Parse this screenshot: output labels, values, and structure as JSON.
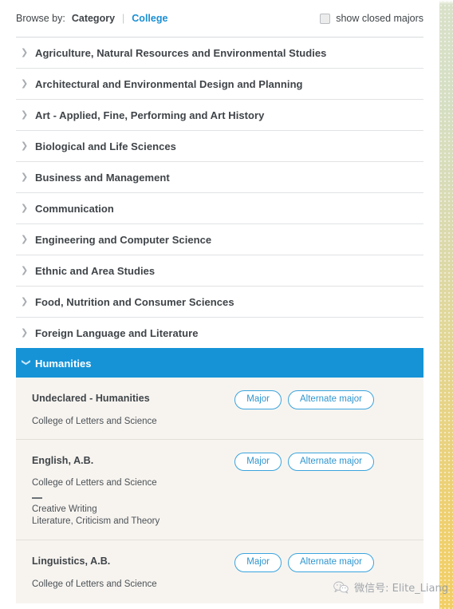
{
  "browse_bar": {
    "label": "Browse by:",
    "options": [
      {
        "label": "Category",
        "active": true
      },
      {
        "label": "College",
        "active": false
      }
    ],
    "separator": "|",
    "checkbox_label": "show closed majors",
    "checkbox_checked": false
  },
  "categories": [
    {
      "label": "Agriculture, Natural Resources and Environmental Studies",
      "expanded": false,
      "chevron": "chevron-right-icon"
    },
    {
      "label": "Architectural and Environmental Design and Planning",
      "expanded": false,
      "chevron": "chevron-right-icon"
    },
    {
      "label": "Art - Applied, Fine, Performing and Art History",
      "expanded": false,
      "chevron": "chevron-right-icon"
    },
    {
      "label": "Biological and Life Sciences",
      "expanded": false,
      "chevron": "chevron-right-icon"
    },
    {
      "label": "Business and Management",
      "expanded": false,
      "chevron": "chevron-right-icon"
    },
    {
      "label": "Communication",
      "expanded": false,
      "chevron": "chevron-right-icon"
    },
    {
      "label": "Engineering and Computer Science",
      "expanded": false,
      "chevron": "chevron-right-icon"
    },
    {
      "label": "Ethnic and Area Studies",
      "expanded": false,
      "chevron": "chevron-right-icon"
    },
    {
      "label": "Food, Nutrition and Consumer Sciences",
      "expanded": false,
      "chevron": "chevron-right-icon"
    },
    {
      "label": "Foreign Language and Literature",
      "expanded": false,
      "chevron": "chevron-right-icon"
    },
    {
      "label": "Humanities",
      "expanded": true,
      "chevron": "chevron-down-icon"
    }
  ],
  "expanded_category": {
    "label": "Humanities",
    "majors": [
      {
        "name": "Undeclared - Humanities",
        "college": "College of Letters and Science",
        "major_button": "Major",
        "alternate_button": "Alternate major",
        "specializations": []
      },
      {
        "name": "English,  A.B.",
        "college": "College of Letters and Science",
        "major_button": "Major",
        "alternate_button": "Alternate major",
        "specializations": [
          "Creative Writing",
          "Literature, Criticism and Theory"
        ]
      },
      {
        "name": "Linguistics,  A.B.",
        "college": "College of Letters and Science",
        "major_button": "Major",
        "alternate_button": "Alternate major",
        "specializations": []
      }
    ]
  },
  "watermark": {
    "icon": "wechat-icon",
    "text": "微信号: Elite_Liang"
  },
  "colors": {
    "accent_blue": "#1693d7",
    "link_blue": "#1b8fd3",
    "panel_background": "#f7f4f0",
    "text_dark": "#3f4448",
    "divider": "#e0e2e4"
  }
}
